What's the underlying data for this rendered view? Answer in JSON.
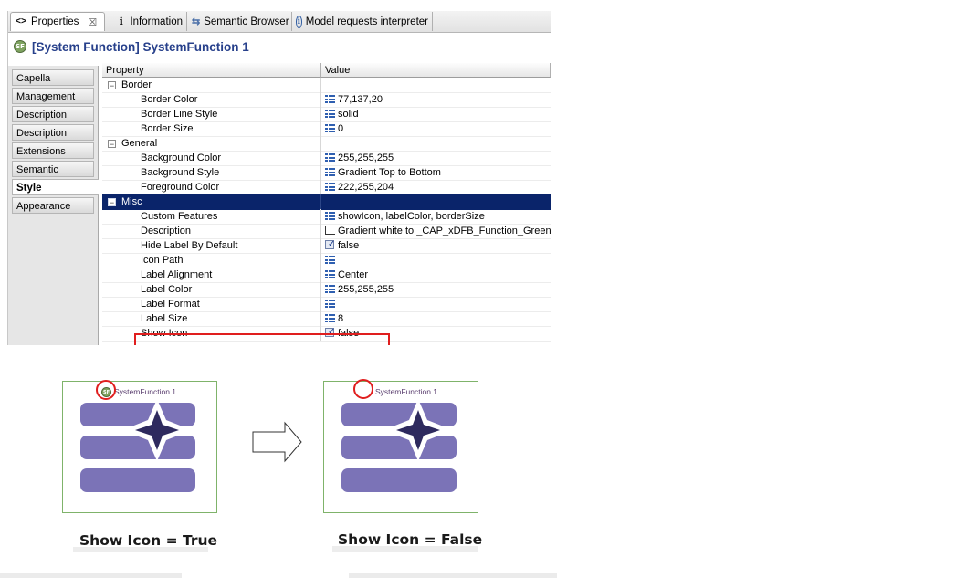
{
  "tabs": [
    {
      "label": "Properties",
      "icon": "properties-icon",
      "active": true
    },
    {
      "label": "Information",
      "icon": "info-icon",
      "active": false
    },
    {
      "label": "Semantic Browser",
      "icon": "semantic-browser-icon",
      "active": false
    },
    {
      "label": "Model requests interpreter",
      "icon": "interpreter-icon",
      "active": false
    }
  ],
  "title": {
    "text": "[System Function] SystemFunction 1",
    "badge": "SF"
  },
  "side_tabs": [
    "Capella",
    "Management",
    "Description",
    "Description",
    "Extensions",
    "Semantic",
    "Style",
    "Appearance"
  ],
  "active_side_tab": "Style",
  "table": {
    "headers": {
      "property": "Property",
      "value": "Value"
    },
    "rows": [
      {
        "type": "group",
        "label": "Border"
      },
      {
        "type": "prop",
        "label": "Border Color",
        "value": "77,137,20",
        "icon": "list-icon"
      },
      {
        "type": "prop",
        "label": "Border Line Style",
        "value": "solid",
        "icon": "list-icon"
      },
      {
        "type": "prop",
        "label": "Border Size",
        "value": "0",
        "icon": "list-icon"
      },
      {
        "type": "group",
        "label": "General"
      },
      {
        "type": "prop",
        "label": "Background Color",
        "value": "255,255,255",
        "icon": "list-icon"
      },
      {
        "type": "prop",
        "label": "Background Style",
        "value": "Gradient Top to Bottom",
        "icon": "list-icon"
      },
      {
        "type": "prop",
        "label": "Foreground Color",
        "value": "222,255,204",
        "icon": "list-icon"
      },
      {
        "type": "group",
        "label": "Misc",
        "selected": true
      },
      {
        "type": "prop",
        "label": "Custom Features",
        "value": "showIcon, labelColor, borderSize",
        "icon": "list-icon"
      },
      {
        "type": "prop",
        "label": "Description",
        "value": "Gradient white to _CAP_xDFB_Function_Green",
        "icon": "doc-icon"
      },
      {
        "type": "prop",
        "label": "Hide Label By Default",
        "value": "false",
        "icon": "check-icon"
      },
      {
        "type": "prop",
        "label": "Icon Path",
        "value": "",
        "icon": "list-icon"
      },
      {
        "type": "prop",
        "label": "Label Alignment",
        "value": "Center",
        "icon": "list-icon"
      },
      {
        "type": "prop",
        "label": "Label Color",
        "value": "255,255,255",
        "icon": "list-icon"
      },
      {
        "type": "prop",
        "label": "Label Format",
        "value": "",
        "icon": "list-icon"
      },
      {
        "type": "prop",
        "label": "Label Size",
        "value": "8",
        "icon": "list-icon"
      },
      {
        "type": "prop",
        "label": "Show Icon",
        "value": "false",
        "icon": "check-icon",
        "highlighted": true
      }
    ]
  },
  "diagrams": [
    {
      "title": "SystemFunction 1",
      "badge": "SF",
      "show_icon": true
    },
    {
      "title": "SystemFunction 1",
      "badge": "",
      "show_icon": false
    }
  ],
  "captions": [
    "Show Icon = True",
    "Show Icon = False"
  ],
  "colors": {
    "selection": "#0a246a",
    "highlight": "#e01e1e",
    "diagram_border": "#7fb36a",
    "bar_fill": "#7b73b7",
    "star_fill": "#2e2a5e",
    "title_blue": "#27408b",
    "sf_badge": "#7fa360"
  }
}
